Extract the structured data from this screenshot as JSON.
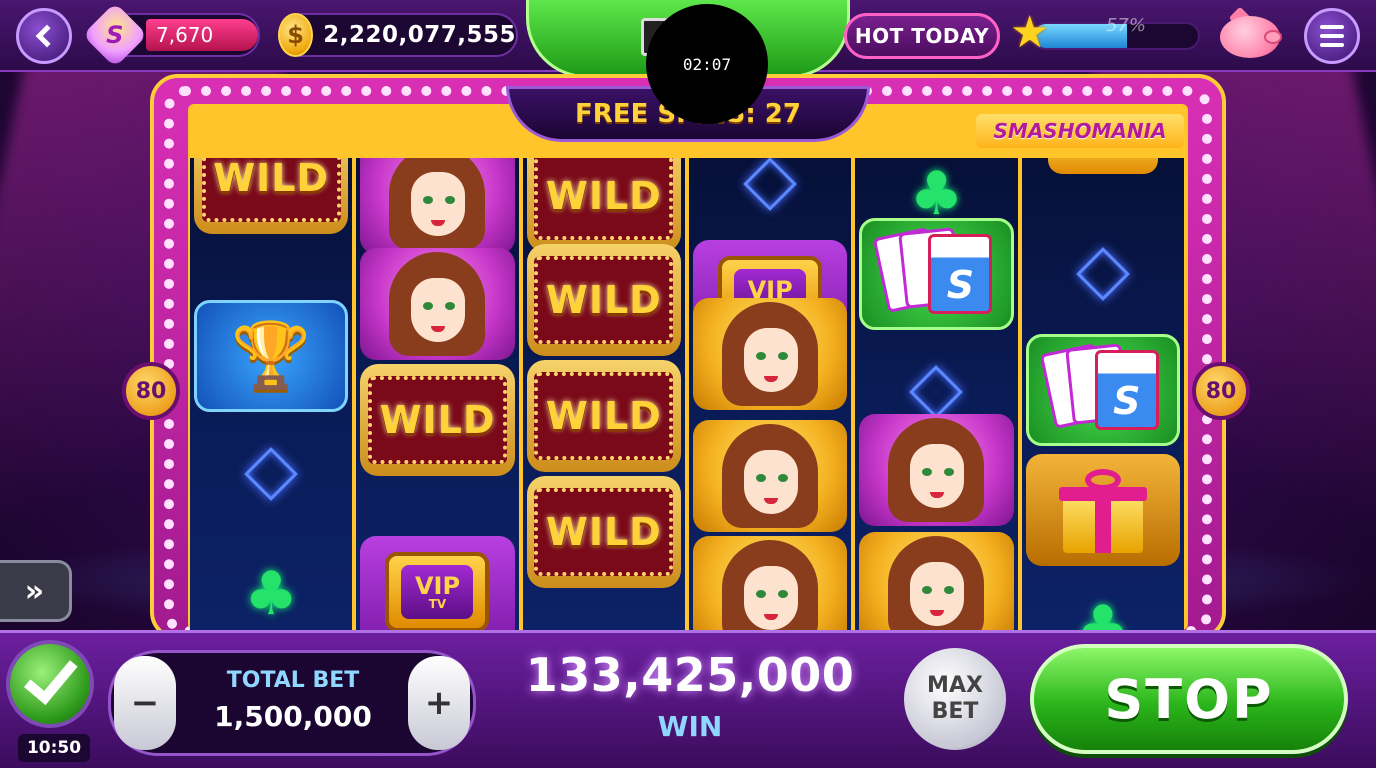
{
  "header": {
    "sbucks_value": "7,670",
    "sbucks_icon_letter": "S",
    "coins_value": "2,220,077,555",
    "coin_icon_symbol": "$",
    "hot_today_label": "HOT TODAY",
    "level_progress_text": "57%",
    "level_progress": 0.57,
    "timer_text": "02:07"
  },
  "machine": {
    "free_spins_text": "FREE SPINS: 27",
    "game_logo": "SMASHOMANIA",
    "payline_left": "80",
    "payline_right": "80",
    "wild_text": "WILD",
    "vip_text": "VIP",
    "vip_sub": "TV",
    "card_letter": "S",
    "reels": [
      [
        {
          "type": "wild"
        },
        {
          "type": "trophy"
        },
        {
          "type": "neon-diamond"
        },
        {
          "type": "neon-club"
        }
      ],
      [
        {
          "type": "lady-pink"
        },
        {
          "type": "lady-pink"
        },
        {
          "type": "wild"
        },
        {
          "type": "vip"
        }
      ],
      [
        {
          "type": "wild"
        },
        {
          "type": "wild"
        },
        {
          "type": "wild"
        },
        {
          "type": "wild"
        }
      ],
      [
        {
          "type": "neon-diamond"
        },
        {
          "type": "vip"
        },
        {
          "type": "lady"
        },
        {
          "type": "lady"
        },
        {
          "type": "lady"
        }
      ],
      [
        {
          "type": "neon-club"
        },
        {
          "type": "cards"
        },
        {
          "type": "neon-diamond"
        },
        {
          "type": "lady-pink"
        },
        {
          "type": "lady"
        }
      ],
      [
        {
          "type": "gold-stack"
        },
        {
          "type": "neon-diamond"
        },
        {
          "type": "cards"
        },
        {
          "type": "gift"
        },
        {
          "type": "neon-club"
        }
      ]
    ]
  },
  "footer": {
    "clock_time": "10:50",
    "minus_label": "−",
    "plus_label": "+",
    "total_bet_label": "TOTAL BET",
    "total_bet_value": "1,500,000",
    "win_value": "133,425,000",
    "win_label": "WIN",
    "max_bet_line1": "MAX",
    "max_bet_line2": "BET",
    "stop_label": "STOP",
    "fast_forward_label": "»"
  },
  "colors": {
    "accent_green": "#2bb51b",
    "accent_gold": "#ffd23a",
    "accent_pink": "#d92fb5",
    "background_purple": "#2a0845"
  }
}
